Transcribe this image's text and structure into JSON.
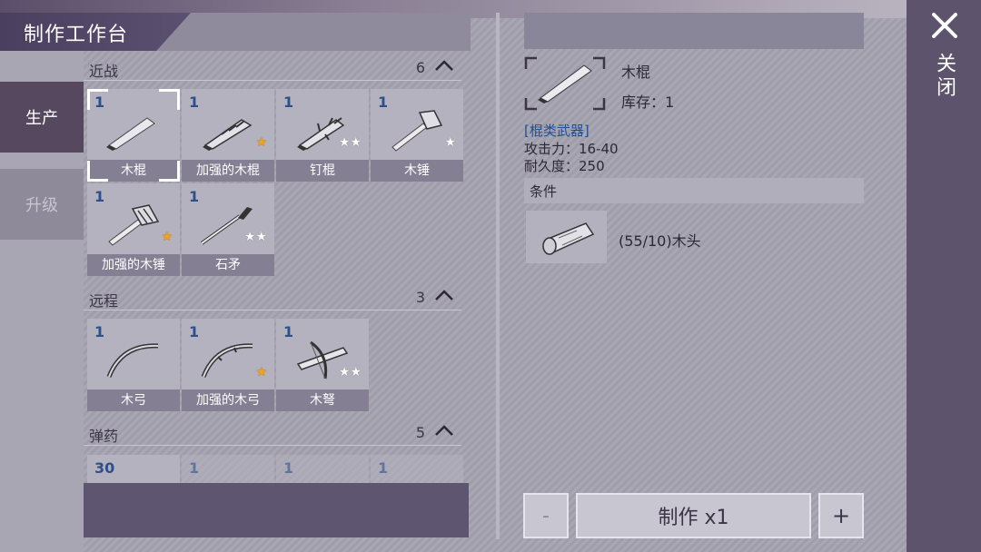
{
  "title": "制作工作台",
  "tabs": {
    "produce": "生产",
    "upgrade": "升级"
  },
  "sections": [
    {
      "name": "近战",
      "count": "6",
      "items": [
        {
          "qty": "1",
          "label": "木棍",
          "stars": "",
          "icon": "wooden-club-icon"
        },
        {
          "qty": "1",
          "label": "加强的木棍",
          "stars": "★",
          "icon": "reinforced-club-icon"
        },
        {
          "qty": "1",
          "label": "钉棍",
          "stars": "★★",
          "icon": "nail-club-icon"
        },
        {
          "qty": "1",
          "label": "木锤",
          "stars": "★",
          "icon": "wooden-hammer-icon"
        },
        {
          "qty": "1",
          "label": "加强的木锤",
          "stars": "★",
          "icon": "reinforced-hammer-icon"
        },
        {
          "qty": "1",
          "label": "石矛",
          "stars": "★★",
          "icon": "stone-spear-icon"
        }
      ]
    },
    {
      "name": "远程",
      "count": "3",
      "items": [
        {
          "qty": "1",
          "label": "木弓",
          "stars": "",
          "icon": "wooden-bow-icon"
        },
        {
          "qty": "1",
          "label": "加强的木弓",
          "stars": "★",
          "icon": "reinforced-bow-icon"
        },
        {
          "qty": "1",
          "label": "木弩",
          "stars": "★★",
          "icon": "crossbow-icon"
        }
      ]
    },
    {
      "name": "弹药",
      "count": "5",
      "items": [
        {
          "qty": "30"
        },
        {
          "qty": "1"
        },
        {
          "qty": "1"
        },
        {
          "qty": "1"
        }
      ]
    }
  ],
  "detail": {
    "name": "木棍",
    "stock": "库存：1",
    "type": "[棍类武器]",
    "attack": "攻击力：16-40",
    "durability": "耐久度：250",
    "conditions_header": "条件",
    "requirement": "(55/10)木头"
  },
  "buttons": {
    "minus": "-",
    "make": "制作 x1",
    "plus": "+"
  },
  "close_label": "关闭",
  "colors": {
    "accent": "#55485f",
    "qty": "#2f4f88",
    "gold_star": "#f2a31a"
  }
}
